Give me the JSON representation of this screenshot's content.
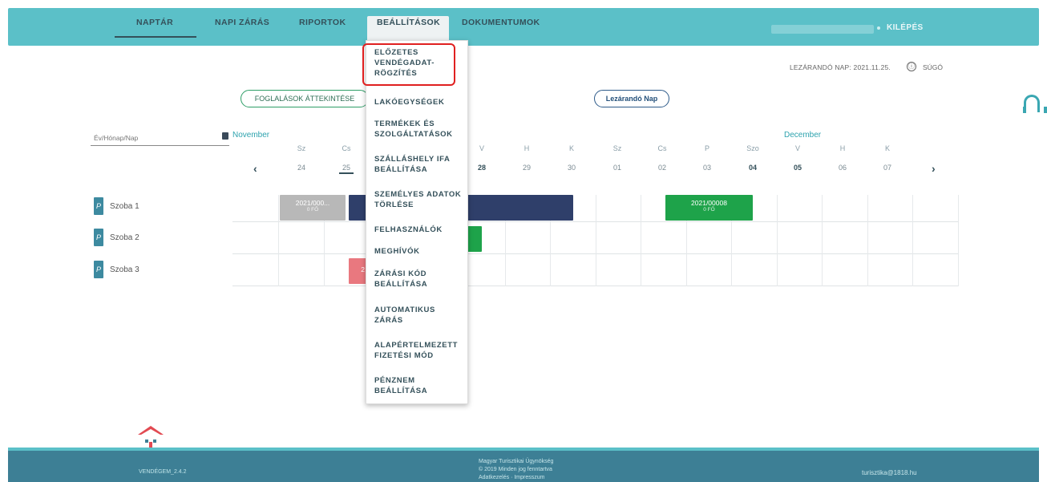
{
  "nav": {
    "items": [
      "NAPTÁR",
      "NAPI ZÁRÁS",
      "RIPORTOK",
      "BEÁLLÍTÁSOK",
      "DOKUMENTUMOK"
    ],
    "logout": "KILÉPÉS"
  },
  "header": {
    "closing_day": "LEZÁRANDÓ NAP: 2021.11.25.",
    "help_icon_glyph": "ⓘ",
    "help": "SÚGÓ"
  },
  "actions": {
    "overview_button": "FOGLALÁSOK ÁTTEKINTÉSE",
    "closing_day_button": "Lezárandó Nap"
  },
  "calendar": {
    "date_placeholder": "Év/Hónap/Nap",
    "months": [
      "November",
      "December"
    ],
    "days": [
      {
        "dow": "Sz",
        "num": "24"
      },
      {
        "dow": "Cs",
        "num": "25"
      },
      {
        "dow": "V",
        "num": "28"
      },
      {
        "dow": "H",
        "num": "29"
      },
      {
        "dow": "K",
        "num": "30"
      },
      {
        "dow": "Sz",
        "num": "01"
      },
      {
        "dow": "Cs",
        "num": "02"
      },
      {
        "dow": "P",
        "num": "03"
      },
      {
        "dow": "Szo",
        "num": "04"
      },
      {
        "dow": "V",
        "num": "05"
      },
      {
        "dow": "H",
        "num": "06"
      },
      {
        "dow": "K",
        "num": "07"
      }
    ],
    "prev": "‹",
    "next": "›"
  },
  "rooms": [
    "Szoba 1",
    "Szoba 2",
    "Szoba 3"
  ],
  "bookings": [
    {
      "label": "2021/000...",
      "sub": "0 FŐ",
      "color": "#b8b8b8"
    },
    {
      "label": "",
      "sub": "",
      "color": "#2f3f6a"
    },
    {
      "label": "2021/00008",
      "sub": "0 FŐ",
      "color": "#1ea34a"
    },
    {
      "label": "",
      "sub": "",
      "color": "#1ea34a"
    },
    {
      "label": "2",
      "sub": "",
      "color": "#e9787f"
    }
  ],
  "settings_menu": [
    "ELŐZETES VENDÉGADAT-RÖGZÍTÉS",
    "LAKÓEGYSÉGEK",
    "TERMÉKEK ÉS SZOLGÁLTATÁSOK",
    "SZÁLLÁSHELY IFA BEÁLLÍTÁSA",
    "SZEMÉLYES ADATOK TÖRLÉSE",
    "FELHASZNÁLÓK",
    "MEGHÍVÓK",
    "ZÁRÁSI KÓD BEÁLLÍTÁSA",
    "AUTOMATIKUS ZÁRÁS",
    "ALAPÉRTELMEZETT FIZETÉSI MÓD",
    "PÉNZNEM BEÁLLÍTÁSA"
  ],
  "footer": {
    "version": "VENDÉGEM_2.4.2",
    "org": "Magyar Turisztikai Ügynökség",
    "rights": "© 2019 Minden jog fenntartva",
    "links": "Adatkezelés · Impresszum",
    "email": "turisztika@1818.hu"
  },
  "colors": {
    "topbar": "#5bc0c8",
    "footer": "#3d7f95",
    "highlight": "#e02020"
  }
}
